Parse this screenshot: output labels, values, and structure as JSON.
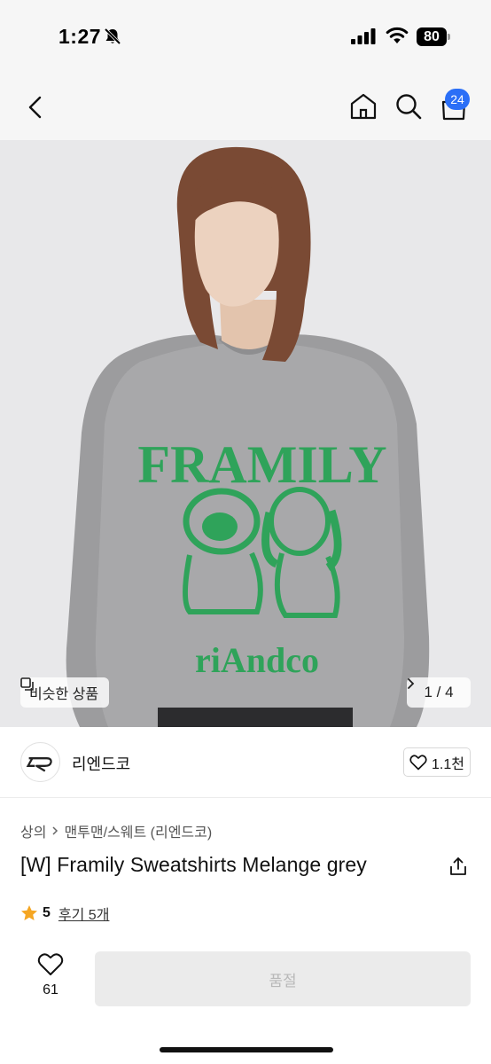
{
  "status_bar": {
    "time": "1:27",
    "battery": "80"
  },
  "nav": {
    "cart_count": "24"
  },
  "hero": {
    "print_text_top": "FRAMILY",
    "print_text_bottom": "riAndco",
    "similar_label": "비슷한 상품",
    "page_current": "1",
    "page_total": "4",
    "page_indicator": "1 / 4"
  },
  "brand": {
    "name": "리엔드코",
    "likes": "1.1천"
  },
  "breadcrumb": {
    "items": [
      "상의",
      "맨투맨/스웨트 (리엔드코)"
    ]
  },
  "product": {
    "title": "[W] Framily Sweatshirts Melange grey",
    "rating": "5",
    "reviews": "후기 5개"
  },
  "bottom": {
    "like_count": "61",
    "soldout_label": "품절"
  },
  "colors": {
    "accent_blue": "#2b6ff7",
    "star": "#f5a623",
    "print_green": "#2fa35a"
  }
}
